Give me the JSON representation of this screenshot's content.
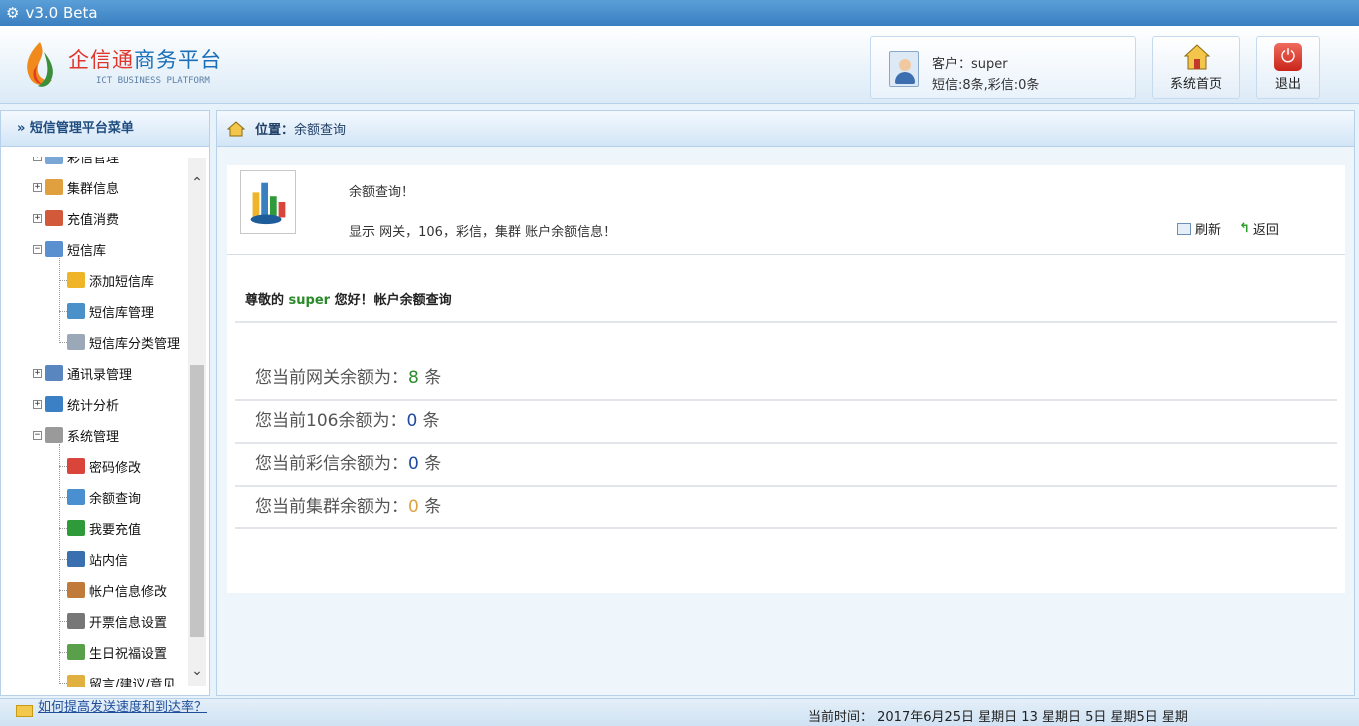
{
  "window": {
    "title": "v3.0  Beta"
  },
  "brand": {
    "name_cn_red": "企信通",
    "name_cn_blue": "商务平台",
    "name_en": "ICT BUSINESS PLATFORM"
  },
  "user": {
    "customer_line": "客户：super",
    "quota_line": "短信:8条,彩信:0条"
  },
  "header_buttons": {
    "home": "系统首页",
    "exit": "退出"
  },
  "sidebar": {
    "title": "» 短信管理平台菜单",
    "items": [
      {
        "label": "彩信管理",
        "level": 0,
        "toggle": "+"
      },
      {
        "label": "集群信息",
        "level": 0,
        "toggle": "+"
      },
      {
        "label": "充值消费",
        "level": 0,
        "toggle": "+"
      },
      {
        "label": "短信库",
        "level": 0,
        "toggle": "−"
      },
      {
        "label": "添加短信库",
        "level": 1
      },
      {
        "label": "短信库管理",
        "level": 1
      },
      {
        "label": "短信库分类管理",
        "level": 1
      },
      {
        "label": "通讯录管理",
        "level": 0,
        "toggle": "+"
      },
      {
        "label": "统计分析",
        "level": 0,
        "toggle": "+"
      },
      {
        "label": "系统管理",
        "level": 0,
        "toggle": "−"
      },
      {
        "label": "密码修改",
        "level": 1
      },
      {
        "label": "余额查询",
        "level": 1
      },
      {
        "label": "我要充值",
        "level": 1
      },
      {
        "label": "站内信",
        "level": 1
      },
      {
        "label": "帐户信息修改",
        "level": 1
      },
      {
        "label": "开票信息设置",
        "level": 1
      },
      {
        "label": "生日祝福设置",
        "level": 1
      },
      {
        "label": "留言/建议/意见",
        "level": 1
      }
    ]
  },
  "breadcrumb": {
    "label": "位置：",
    "value": "余额查询"
  },
  "info": {
    "title": "余额查询！",
    "desc": "显示 网关，106，彩信，集群 账户余额信息！",
    "refresh": "刷新",
    "back": "返回"
  },
  "greeting": {
    "prefix": "尊敬的 ",
    "name": "super",
    "suffix": " 您好！帐户余额查询"
  },
  "balances": [
    {
      "label": "您当前网关余额为：",
      "value": "8",
      "unit": " 条"
    },
    {
      "label": "您当前106余额为：",
      "value": "0",
      "unit": " 条"
    },
    {
      "label": "您当前彩信余额为：",
      "value": "0",
      "unit": " 条"
    },
    {
      "label": "您当前集群余额为：",
      "value": "0",
      "unit": " 条"
    }
  ],
  "statusbar": {
    "link": "如何提高发送速度和到达率？",
    "time": "当前时间： 2017年6月25日 星期日 13  星期日 5日  星期5日  星期"
  },
  "colors": {
    "accent": "#3a7fc0",
    "gateway_value": "#2e8b2e",
    "value_blue": "#1f4ba0",
    "cluster_value": "#e0a040"
  }
}
